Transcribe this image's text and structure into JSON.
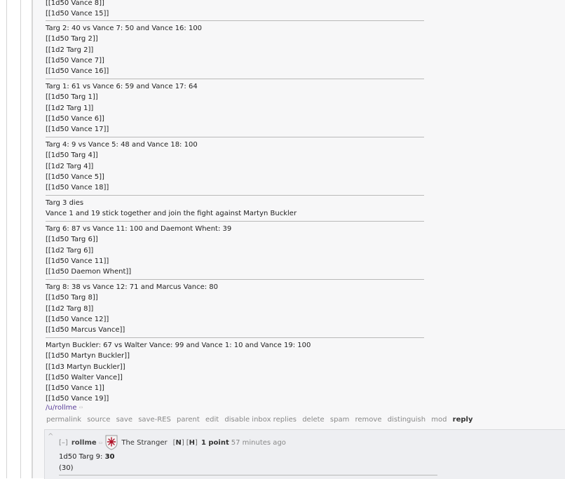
{
  "comment": {
    "blocks": [
      {
        "lines": [
          "[[1d50 Vance 8]]",
          "[[1d50 Vance 15]]"
        ]
      },
      {
        "lines": [
          "Targ 2: 40 vs Vance 7: 50 and Vance 16: 100",
          "[[1d50 Targ 2]]",
          "[[1d2 Targ 2]]",
          "[[1d50 Vance 7]]",
          "[[1d50 Vance 16]]"
        ]
      },
      {
        "lines": [
          "Targ 1: 61 vs Vance 6: 59 and Vance 17: 64",
          "[[1d50 Targ 1]]",
          "[[1d2 Targ 1]]",
          "[[1d50 Vance 6]]",
          "[[1d50 Vance 17]]"
        ]
      },
      {
        "lines": [
          "Targ 4: 9 vs Vance 5: 48 and Vance 18: 100",
          "[[1d50 Targ 4]]",
          "[[1d2 Targ 4]]",
          "[[1d50 Vance 5]]",
          "[[1d50 Vance 18]]"
        ]
      },
      {
        "lines": [
          "Targ 3 dies",
          "Vance 1 and 19 stick together and join the fight against Martyn Buckler"
        ]
      },
      {
        "lines": [
          "Targ 6: 87 vs Vance 11: 100 and Daemont Whent: 39",
          "[[1d50 Targ 6]]",
          "[[1d2 Targ 6]]",
          "[[1d50 Vance 11]]",
          "[[1d50 Daemon Whent]]"
        ]
      },
      {
        "lines": [
          "Targ 8: 38 vs Vance 12: 71 and Marcus Vance: 80",
          "[[1d50 Targ 8]]",
          "[[1d2 Targ 8]]",
          "[[1d50 Vance 12]]",
          "[[1d50 Marcus Vance]]"
        ]
      },
      {
        "lines": [
          "Martyn Buckler: 67 vs Walter Vance: 99 and Vance 1: 10 and Vance 19: 100",
          "[[1d50 Martyn Buckler]]",
          "[[1d3 Martyn Buckler]]",
          "[[1d50 Walter Vance]]",
          "[[1d50 Vance 1]]",
          "[[1d50 Vance 19]]"
        ]
      }
    ],
    "user_link": "/u/rollme",
    "user_link_mark": "▭",
    "actions": [
      "permalink",
      "source",
      "save",
      "save-RES",
      "parent",
      "edit",
      "disable inbox replies",
      "delete",
      "spam",
      "remove",
      "distinguish",
      "mod"
    ],
    "reply_label": "reply"
  },
  "child_comment": {
    "collapse_icon": "^",
    "toggle": "[–]",
    "author": "rollme",
    "author_mark": "▭",
    "flair_icon": "stranger-shield-icon",
    "flair_text": "The Stranger",
    "bracket_n": "N",
    "bracket_h": "H",
    "score": "1 point",
    "time": "57 minutes ago",
    "roll_label": "1d50 Targ 9: ",
    "roll_result": "30",
    "roll_detail": "(30)"
  },
  "colors": {
    "background": "#ffffff",
    "panel": "#f7f7f8",
    "child_panel": "#eeeff2",
    "separator": "#b9b9b9",
    "user_link": "#5b3f9a",
    "action_text": "#888888",
    "flair_red": "#b0142a"
  }
}
